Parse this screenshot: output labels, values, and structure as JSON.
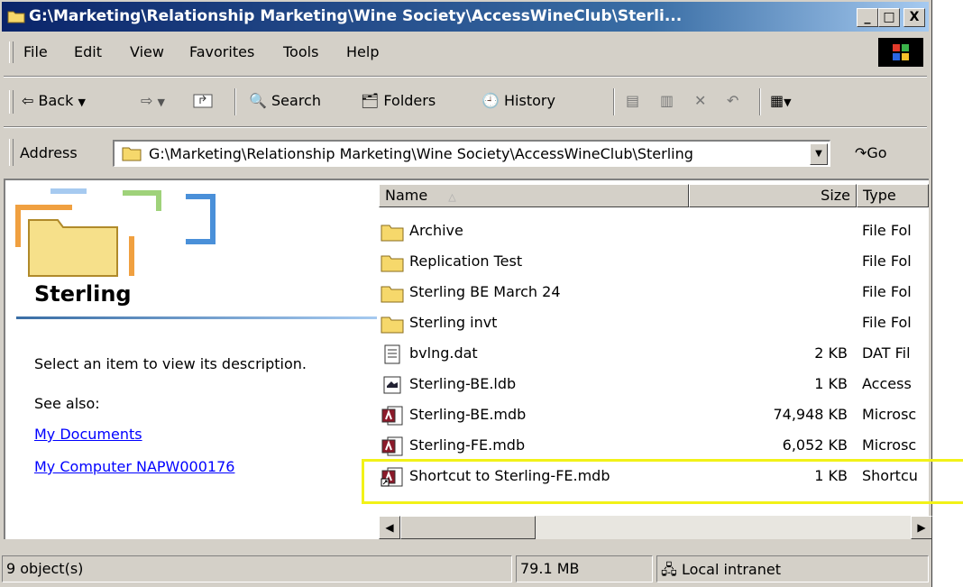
{
  "window": {
    "title": "G:\\Marketing\\Relationship Marketing\\Wine Society\\AccessWineClub\\Sterli...",
    "minimize_label": "_",
    "maximize_label": "□",
    "close_label": "X"
  },
  "menu": [
    "File",
    "Edit",
    "View",
    "Favorites",
    "Tools",
    "Help"
  ],
  "toolbar": {
    "back": "Back",
    "search": "Search",
    "folders": "Folders",
    "history": "History"
  },
  "address": {
    "label": "Address",
    "value": "G:\\Marketing\\Relationship Marketing\\Wine Society\\AccessWineClub\\Sterling",
    "go": "Go"
  },
  "left_pane": {
    "folder_name": "Sterling",
    "description": "Select an item to view its description.",
    "see_also": "See also:",
    "links": [
      "My Documents",
      "My Computer NAPW000176"
    ]
  },
  "columns": {
    "name": "Name",
    "size": "Size",
    "type": "Type"
  },
  "files": [
    {
      "name": "Archive",
      "size": "",
      "type": "File Fol",
      "icon": "folder-icon"
    },
    {
      "name": "Replication Test",
      "size": "",
      "type": "File Fol",
      "icon": "folder-icon"
    },
    {
      "name": "Sterling BE March 24",
      "size": "",
      "type": "File Fol",
      "icon": "folder-icon"
    },
    {
      "name": "Sterling invt",
      "size": "",
      "type": "File Fol",
      "icon": "folder-icon"
    },
    {
      "name": "bvlng.dat",
      "size": "2 KB",
      "type": "DAT Fil",
      "icon": "text-file-icon"
    },
    {
      "name": "Sterling-BE.ldb",
      "size": "1 KB",
      "type": "Access",
      "icon": "ldb-file-icon"
    },
    {
      "name": "Sterling-BE.mdb",
      "size": "74,948 KB",
      "type": "Microsc",
      "icon": "access-db-icon"
    },
    {
      "name": "Sterling-FE.mdb",
      "size": "6,052 KB",
      "type": "Microsc",
      "icon": "access-db-icon"
    },
    {
      "name": "Shortcut to Sterling-FE.mdb",
      "size": "1 KB",
      "type": "Shortcu",
      "icon": "shortcut-icon"
    }
  ],
  "status": {
    "objects": "9 object(s)",
    "size": "79.1 MB",
    "zone": "Local intranet"
  },
  "colors": {
    "title_gradient_start": "#0a246a",
    "title_gradient_end": "#a6caf0",
    "highlight": "#f2f218",
    "link": "#0000ff"
  }
}
